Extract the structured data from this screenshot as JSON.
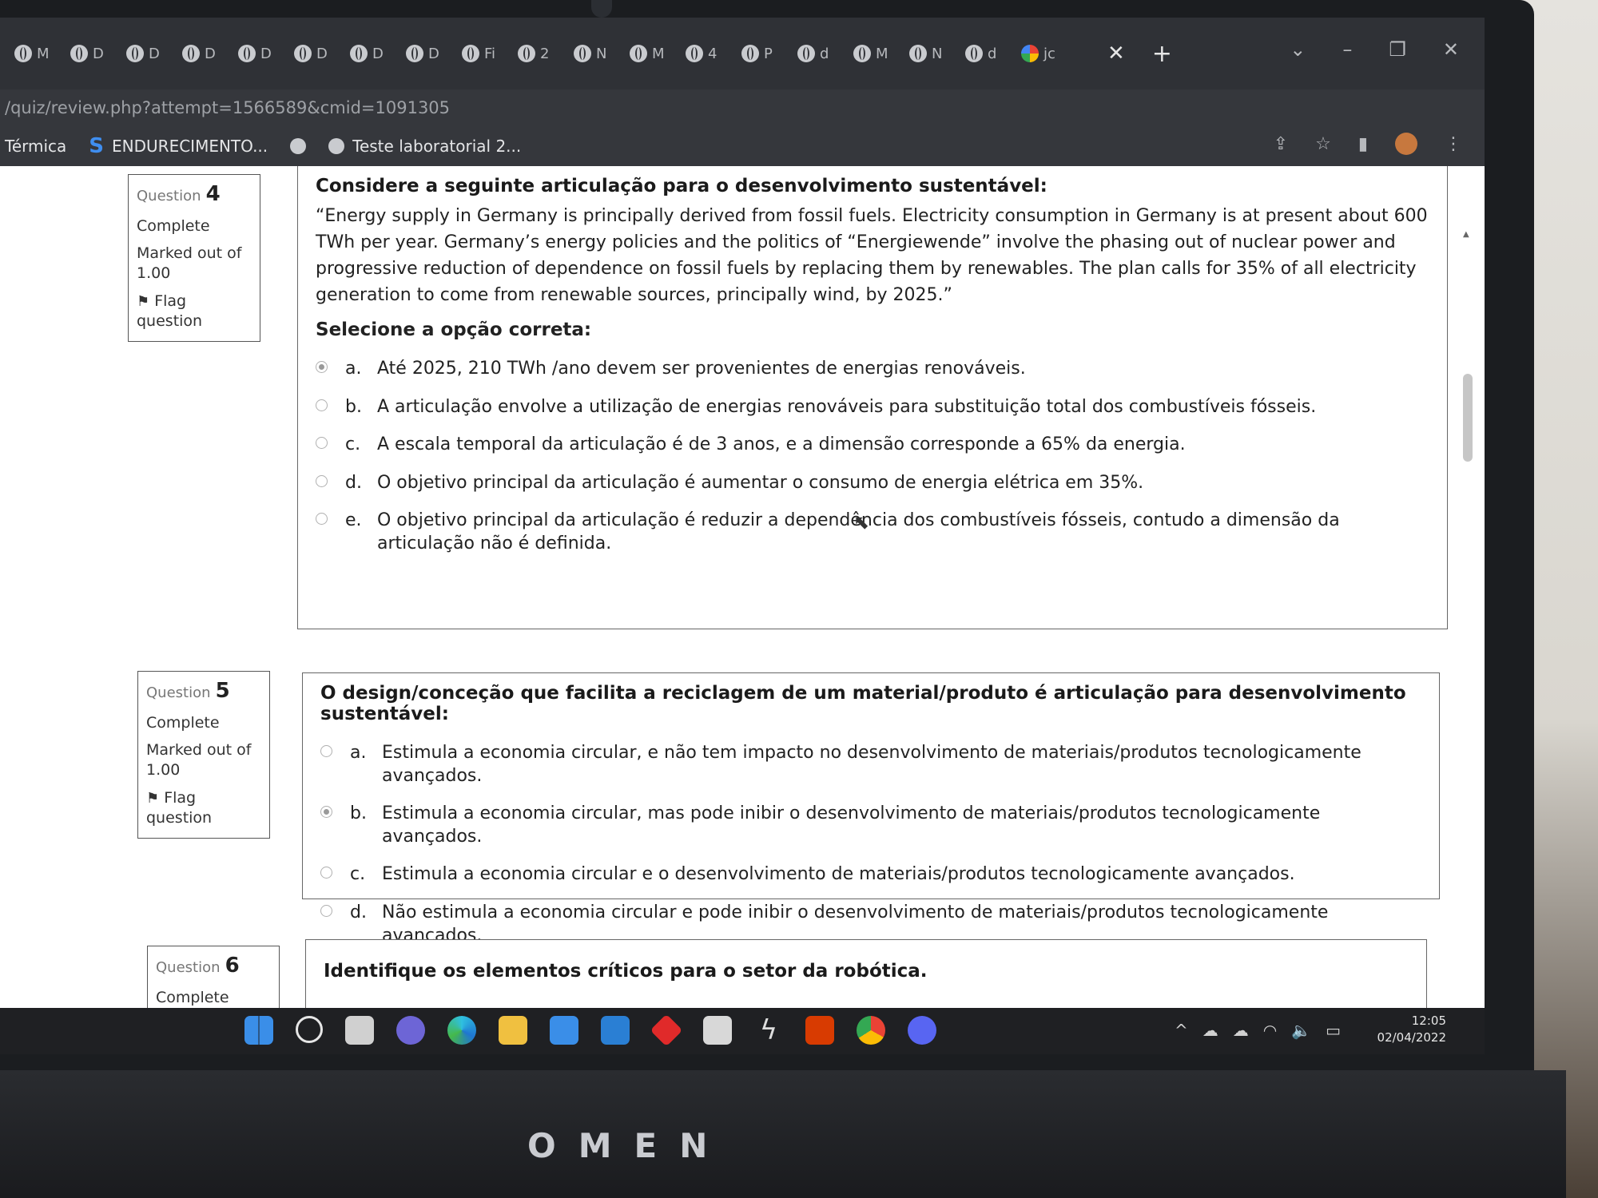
{
  "browser": {
    "tabs": [
      {
        "label": "M"
      },
      {
        "label": "D"
      },
      {
        "label": "D"
      },
      {
        "label": "D"
      },
      {
        "label": "D"
      },
      {
        "label": "D"
      },
      {
        "label": "D"
      },
      {
        "label": "D"
      },
      {
        "label": "Fi"
      },
      {
        "label": "2"
      },
      {
        "label": "N"
      },
      {
        "label": "M"
      },
      {
        "label": "4"
      },
      {
        "label": "P"
      },
      {
        "label": "d"
      },
      {
        "label": "M"
      },
      {
        "label": "N"
      },
      {
        "label": "d"
      }
    ],
    "active_tab_label": "jc",
    "url": "/quiz/review.php?attempt=1566589&cmid=1091305",
    "bookmarks": [
      {
        "label": "Térmica"
      },
      {
        "label": "ENDURECIMENTO..."
      },
      {
        "label": ""
      },
      {
        "label": "Teste laboratorial 2..."
      }
    ]
  },
  "questions": [
    {
      "number_label": "Question",
      "number": "4",
      "state": "Complete",
      "marked": "Marked out of 1.00",
      "flag_label": "Flag question",
      "title": "Considere a seguinte articulação para o desenvolvimento sustentável:",
      "text": "“Energy supply in Germany is principally derived from fossil fuels. Electricity consumption in Germany is at present about 600 TWh per year. Germany’s energy policies and the politics of “Energiewende” involve the phasing out of nuclear power and progressive reduction of dependence on fossil fuels by replacing them by renewables. The plan calls for 35% of all electricity generation to come from renewable sources, principally wind, by 2025.”",
      "prompt": "Selecione a opção correta:",
      "answers": [
        {
          "letter": "a.",
          "text": "Até 2025, 210 TWh /ano devem ser provenientes de energias renováveis.",
          "selected": true
        },
        {
          "letter": "b.",
          "text": "A articulação envolve a utilização de energias renováveis para substituição total dos combustíveis fósseis.",
          "selected": false
        },
        {
          "letter": "c.",
          "text": "A escala temporal da articulação é de 3 anos, e a dimensão corresponde a 65% da energia.",
          "selected": false
        },
        {
          "letter": "d.",
          "text": "O objetivo principal da articulação é aumentar o consumo de energia elétrica em 35%.",
          "selected": false
        },
        {
          "letter": "e.",
          "text": "O objetivo principal da articulação é reduzir a dependência dos combustíveis fósseis, contudo a dimensão da articulação não é definida.",
          "selected": false
        }
      ]
    },
    {
      "number_label": "Question",
      "number": "5",
      "state": "Complete",
      "marked": "Marked out of 1.00",
      "flag_label": "Flag question",
      "title": "O design/conceção que facilita a reciclagem de um material/produto é articulação para desenvolvimento sustentável:",
      "answers": [
        {
          "letter": "a.",
          "text": "Estimula a economia circular, e não tem impacto no desenvolvimento de materiais/produtos tecnologicamente avançados.",
          "selected": false
        },
        {
          "letter": "b.",
          "text": "Estimula a economia circular, mas pode inibir o desenvolvimento de materiais/produtos tecnologicamente avançados.",
          "selected": true
        },
        {
          "letter": "c.",
          "text": "Estimula a economia circular e o desenvolvimento de materiais/produtos tecnologicamente avançados.",
          "selected": false
        },
        {
          "letter": "d.",
          "text": "Não estimula a economia circular e pode inibir o desenvolvimento de materiais/produtos tecnologicamente avançados.",
          "selected": false
        }
      ]
    },
    {
      "number_label": "Question",
      "number": "6",
      "state": "Complete",
      "title": "Identifique os elementos críticos para o setor da robótica."
    }
  ],
  "taskbar": {
    "time": "12:05",
    "date": "02/04/2022"
  },
  "brand": "OMEN"
}
